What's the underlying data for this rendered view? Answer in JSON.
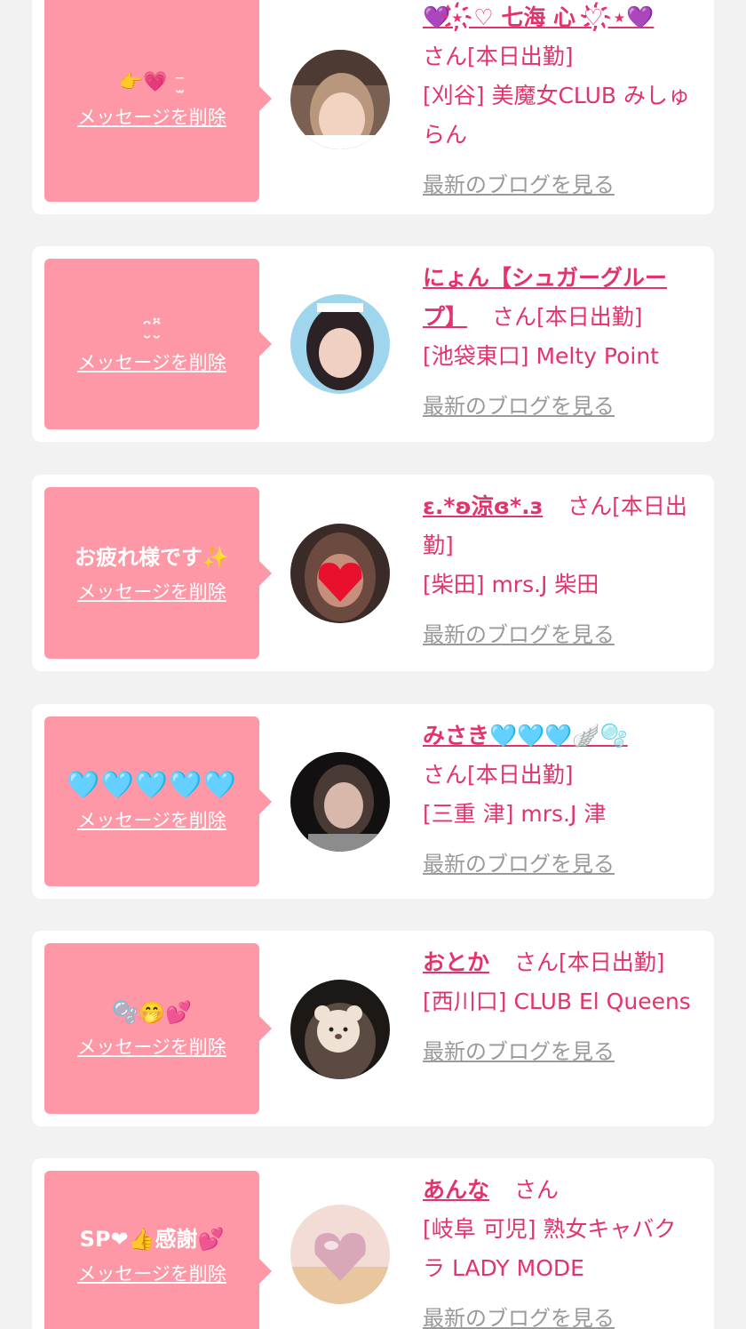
{
  "cards": [
    {
      "message": "👉💗 ⁻̫ ",
      "delete_label": "メッセージを削除",
      "name": "💜⋆҉♡ 七海 心 ♡҉⋆💜",
      "san": "さん",
      "status": "[本日出勤]",
      "shop": "[刈谷] 美魔女CLUB みしゅらん",
      "blog_label": "最新のブログを見る",
      "avatar_colors": [
        "#7a6052",
        "#d9b9a4",
        "#f2d3c1"
      ]
    },
    {
      "message": "ᵔ̮ᵔ̮̈",
      "delete_label": "メッセージを削除",
      "name": "にょん【シュガーグループ】",
      "san": "さん",
      "status": "[本日出勤]",
      "shop": "[池袋東口] Melty Point",
      "blog_label": "最新のブログを見る",
      "avatar_colors": [
        "#9fd6ee",
        "#2c2226",
        "#f1d0c4"
      ]
    },
    {
      "message": "お疲れ様です✨",
      "delete_label": "メッセージを削除",
      "name": "ε.*ʚ涼ɞ*.з",
      "san": "さん",
      "status": "[本日出勤]",
      "shop": "[柴田] mrs.J 柴田",
      "blog_label": "最新のブログを見る",
      "avatar_colors": [
        "#3a2a28",
        "#c58f7c",
        "#e8102c"
      ]
    },
    {
      "message": "🩵🩵🩵🩵🩵",
      "delete_label": "メッセージを削除",
      "name": "みさき🩵🩵🩵🪽🫧",
      "san": "さん",
      "status": "[本日出勤]",
      "shop": "[三重 津] mrs.J 津",
      "blog_label": "最新のブログを見る",
      "avatar_colors": [
        "#121010",
        "#4a3a36",
        "#d8b8aa"
      ]
    },
    {
      "message": "🫧🤭💕",
      "delete_label": "メッセージを削除",
      "name": "おとか",
      "san": "さん",
      "status": "[本日出勤]",
      "shop": "[西川口] CLUB El Queens",
      "blog_label": "最新のブログを見る",
      "avatar_colors": [
        "#1c1816",
        "#5a4a42",
        "#efe2d4"
      ]
    },
    {
      "message": "SP❤👍感謝💕",
      "delete_label": "メッセージを削除",
      "name": "あんな",
      "san": "さん",
      "status": "",
      "shop": "[岐阜 可児] 熟女キャバクラ LADY MODE",
      "blog_label": "最新のブログを見る",
      "avatar_colors": [
        "#f4dcd6",
        "#d8a7b8",
        "#b38a6a"
      ]
    }
  ]
}
